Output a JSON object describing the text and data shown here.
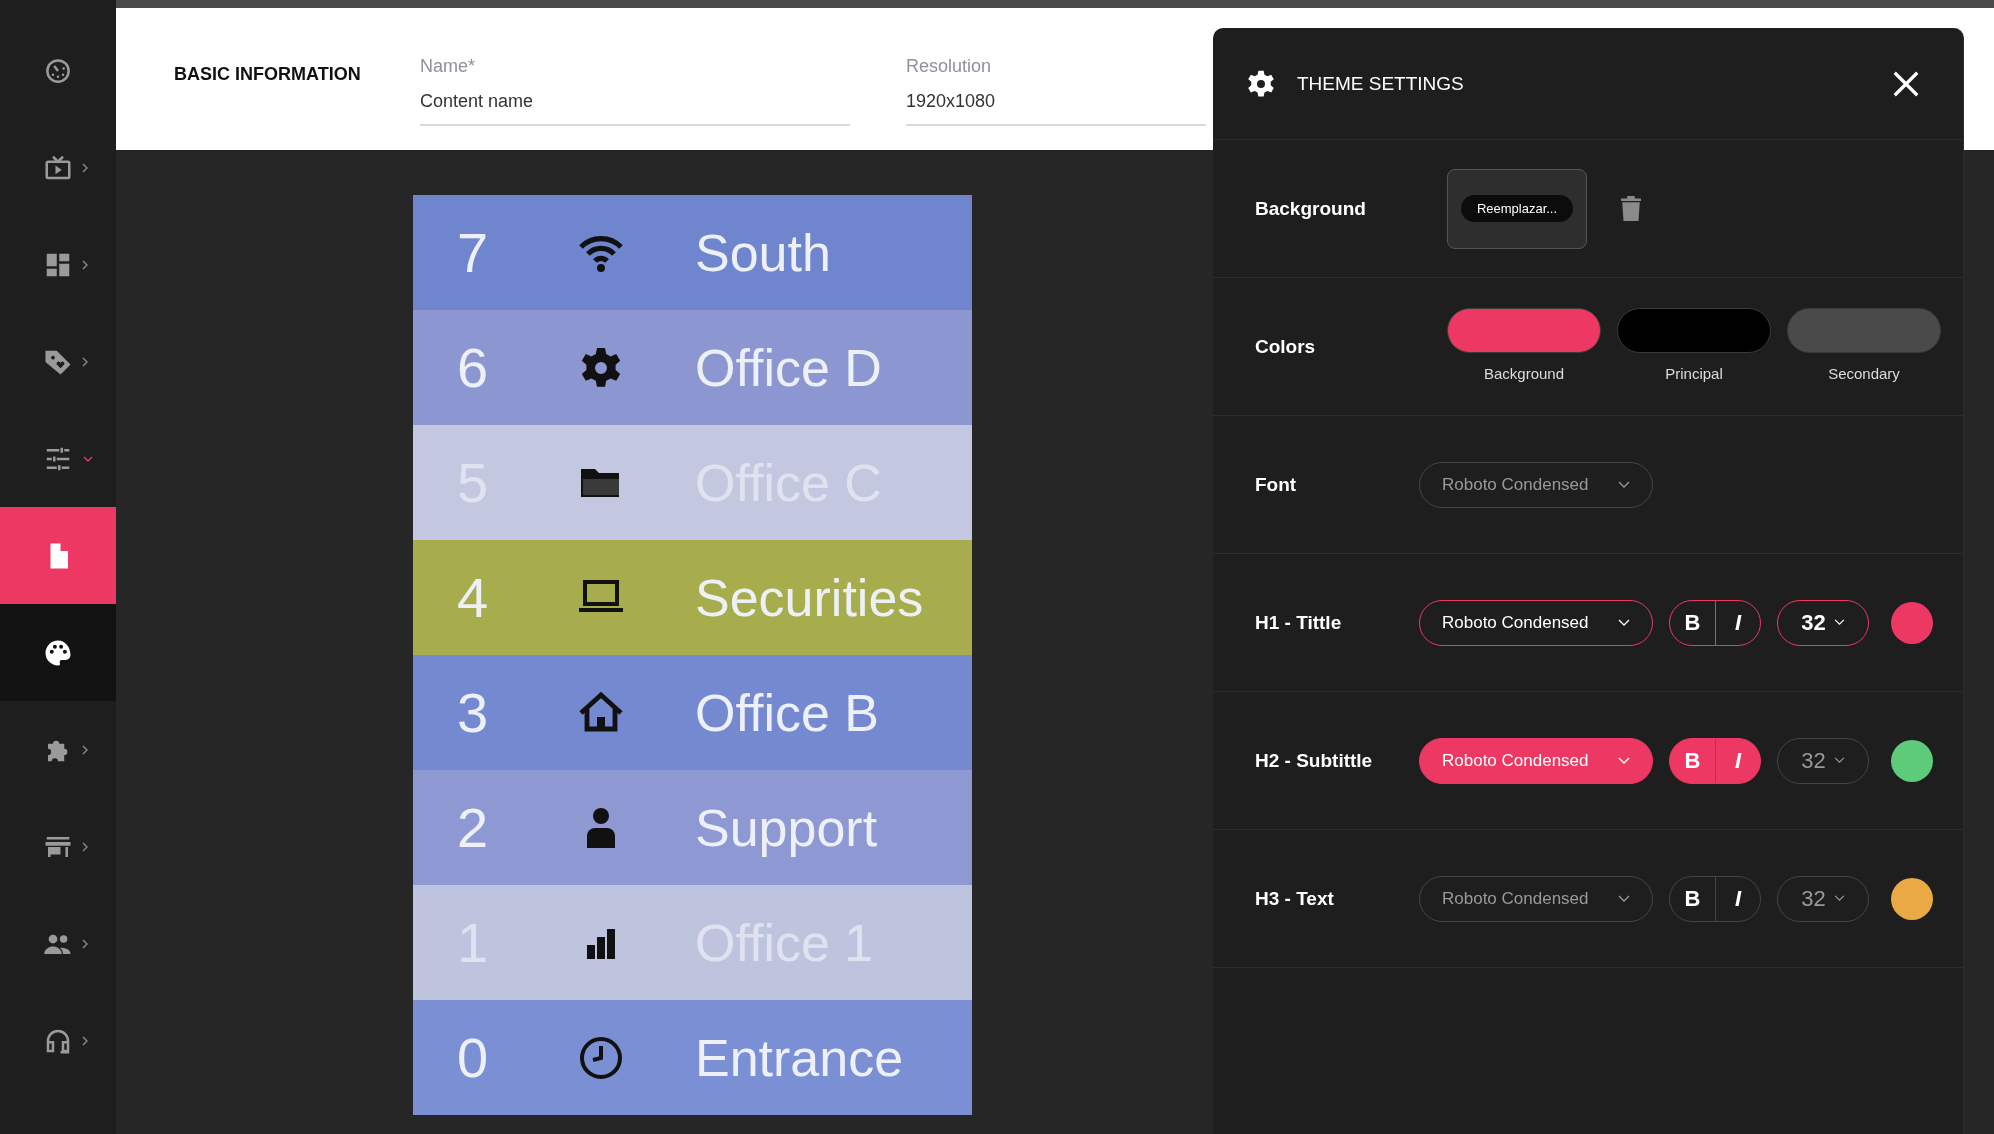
{
  "sidebar": {
    "items": [
      {
        "kind": "link",
        "selected": false
      },
      {
        "kind": "group",
        "expanded": false,
        "selected": false
      },
      {
        "kind": "group",
        "expanded": false,
        "selected": false
      },
      {
        "kind": "group",
        "expanded": false,
        "selected": false
      },
      {
        "kind": "group",
        "expanded": true,
        "selected": false
      },
      {
        "kind": "subitem",
        "selected": true
      },
      {
        "kind": "subitem",
        "selected": false
      },
      {
        "kind": "group",
        "expanded": false,
        "selected": false
      },
      {
        "kind": "group",
        "expanded": false,
        "selected": false
      },
      {
        "kind": "group",
        "expanded": false,
        "selected": false
      },
      {
        "kind": "group",
        "expanded": false,
        "selected": false
      }
    ]
  },
  "basic_information": {
    "title": "BASIC INFORMATION",
    "fields": [
      {
        "label": "Name*",
        "value": "Content name"
      },
      {
        "label": "Resolution",
        "value": "1920x1080"
      }
    ]
  },
  "preview": {
    "rows": [
      {
        "number": "7",
        "label": "South",
        "color": "#6f86cf"
      },
      {
        "number": "6",
        "label": "Office D",
        "color": "#8c97d2"
      },
      {
        "number": "5",
        "label": "Office C",
        "color": "#c3c8e0"
      },
      {
        "number": "4",
        "label": "Securities",
        "color": "#a7ad4c"
      },
      {
        "number": "3",
        "label": "Office B",
        "color": "#7489d0"
      },
      {
        "number": "2",
        "label": "Support",
        "color": "#8e98d3"
      },
      {
        "number": "1",
        "label": "Office 1",
        "color": "#bfc4de"
      },
      {
        "number": "0",
        "label": "Entrance",
        "color": "#7b90d4"
      }
    ]
  },
  "theme_settings": {
    "title": "THEME SETTINGS",
    "background": {
      "label": "Background",
      "button": "Reemplazar..."
    },
    "colors": {
      "label": "Colors",
      "swatches": [
        {
          "label": "Background",
          "color": "#ec3862"
        },
        {
          "label": "Principal",
          "color": "#000000"
        },
        {
          "label": "Secondary",
          "color": "#4a4a4a"
        }
      ]
    },
    "font": {
      "label": "Font",
      "value": "Roboto Condensed"
    },
    "text_styles": [
      {
        "label": "H1 - Tittle",
        "kind": "outlined",
        "font": "Roboto Condensed",
        "bold": "B",
        "italic": "I",
        "size": "32",
        "color": "#ec3862"
      },
      {
        "label": "H2 - Subtittle",
        "kind": "filled",
        "font": "Roboto Condensed",
        "bold": "B",
        "italic": "I",
        "size": "32",
        "color": "#5ecb7a"
      },
      {
        "label": "H3 - Text",
        "kind": "plain",
        "font": "Roboto Condensed",
        "bold": "B",
        "italic": "I",
        "size": "32",
        "color": "#eaa944"
      }
    ]
  }
}
